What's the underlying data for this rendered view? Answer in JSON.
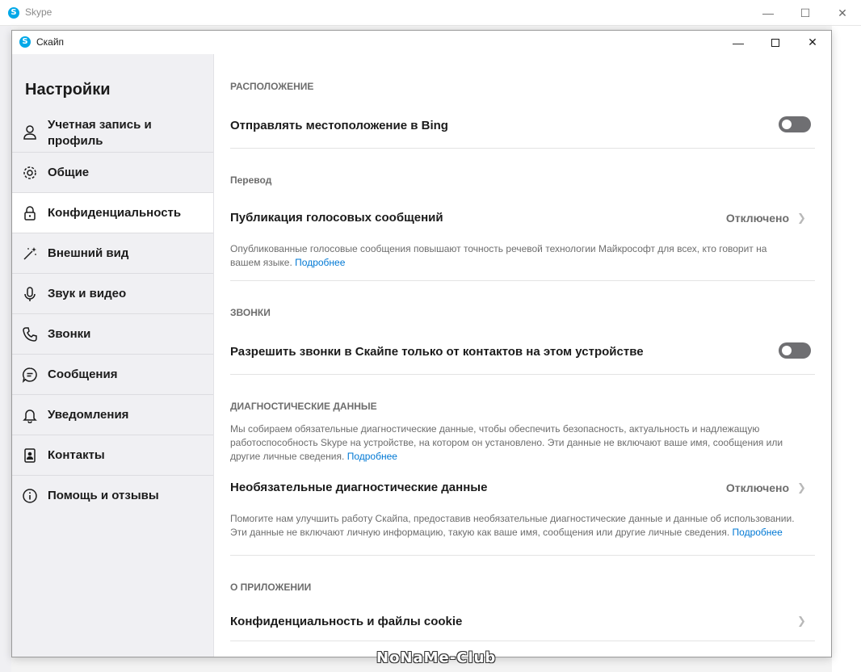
{
  "background_window": {
    "title": "Skype"
  },
  "dialog": {
    "title": "Скайп"
  },
  "sidebar": {
    "heading": "Настройки",
    "items": [
      {
        "label": "Учетная запись и профиль",
        "icon": "person-icon",
        "active": false
      },
      {
        "label": "Общие",
        "icon": "gear-icon",
        "active": false
      },
      {
        "label": "Конфиденциальность",
        "icon": "lock-icon",
        "active": true
      },
      {
        "label": "Внешний вид",
        "icon": "magic-wand-icon",
        "active": false
      },
      {
        "label": "Звук и видео",
        "icon": "microphone-icon",
        "active": false
      },
      {
        "label": "Звонки",
        "icon": "phone-icon",
        "active": false
      },
      {
        "label": "Сообщения",
        "icon": "chat-icon",
        "active": false
      },
      {
        "label": "Уведомления",
        "icon": "bell-icon",
        "active": false
      },
      {
        "label": "Контакты",
        "icon": "contacts-icon",
        "active": false
      },
      {
        "label": "Помощь и отзывы",
        "icon": "info-icon",
        "active": false
      }
    ]
  },
  "content": {
    "location": {
      "header": "РАСПОЛОЖЕНИЕ",
      "bing_label": "Отправлять местоположение в Bing",
      "bing_enabled": false
    },
    "translation": {
      "header": "Перевод",
      "voice_label": "Публикация голосовых сообщений",
      "voice_value": "Отключено",
      "voice_desc": "Опубликованные голосовые сообщения повышают точность речевой технологии Майкрософт для всех, кто говорит на вашем языке.",
      "voice_link": "Подробнее"
    },
    "calls": {
      "header": "ЗВОНКИ",
      "contacts_only_label": "Разрешить звонки в Скайпе только от контактов на этом устройстве",
      "contacts_only_enabled": false
    },
    "diagnostics": {
      "header": "ДИАГНОСТИЧЕСКИЕ ДАННЫЕ",
      "desc": "Мы собираем обязательные диагностические данные, чтобы обеспечить безопасность, актуальность и надлежащую работоспособность Skype на устройстве, на котором он установлено. Эти данные не включают ваше имя, сообщения или другие личные сведения.",
      "desc_link": "Подробнее",
      "optional_label": "Необязательные диагностические данные",
      "optional_value": "Отключено",
      "optional_desc": "Помогите нам улучшить работу Скайпа, предоставив необязательные диагностические данные и данные об использовании. Эти данные не включают личную информацию, такую как ваше имя, сообщения или другие личные сведения.",
      "optional_link": "Подробнее"
    },
    "about": {
      "header": "О ПРИЛОЖЕНИИ",
      "privacy_cookies_label": "Конфиденциальность и файлы cookie"
    }
  },
  "watermark": "NoNaMe-Club",
  "colors": {
    "accent": "#0078d4",
    "toggle_off": "#6f6f72",
    "sidebar_bg": "#f0f0f3"
  }
}
